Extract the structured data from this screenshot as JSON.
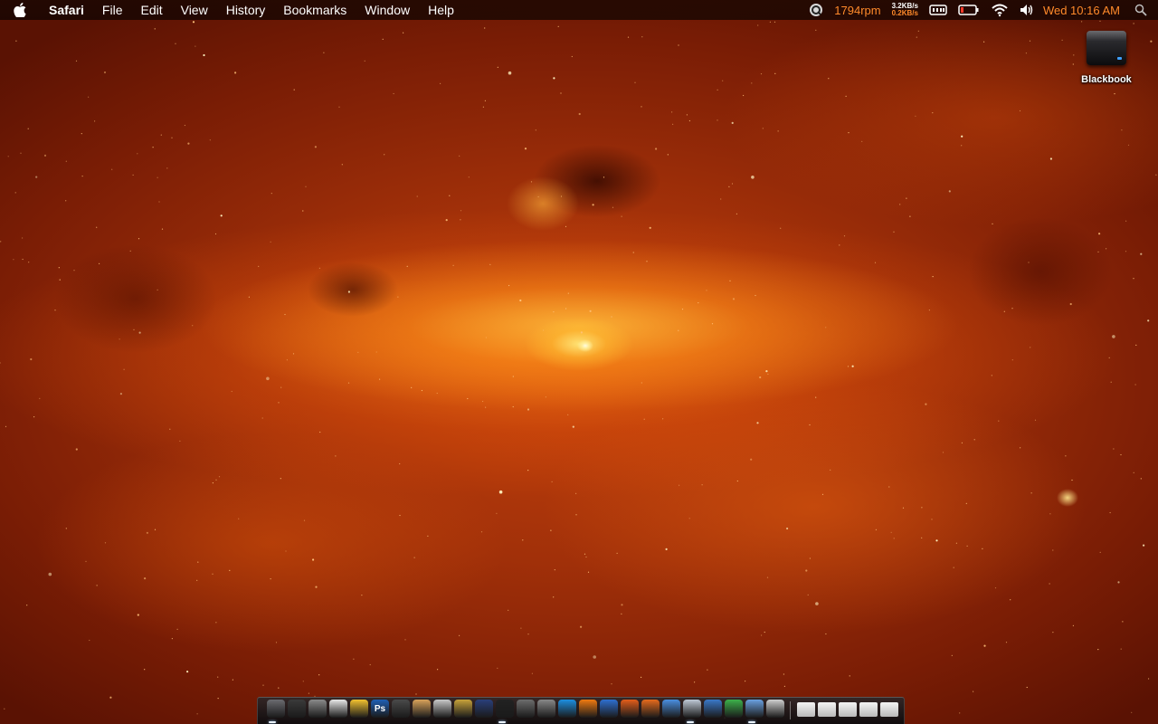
{
  "menubar": {
    "app_name": "Safari",
    "items": [
      "File",
      "Edit",
      "View",
      "History",
      "Bookmarks",
      "Window",
      "Help"
    ],
    "status": {
      "fan_speed": "1794rpm",
      "net_up": "3.2KB/s",
      "net_down": "0.2KB/s",
      "clock": "Wed 10:16 AM"
    },
    "icons": [
      "apple-icon",
      "quicksilver-icon",
      "memory-icon",
      "battery-icon",
      "wifi-icon",
      "volume-icon",
      "spotlight-icon"
    ],
    "accent_color": "#ff8a2a"
  },
  "desktop": {
    "drive_label": "Blackbook"
  },
  "dock": {
    "apps": [
      {
        "name": "Pixelmator"
      },
      {
        "name": "Dashboard"
      },
      {
        "name": "Screenshot"
      },
      {
        "name": "iCal"
      },
      {
        "name": "Things"
      },
      {
        "name": "Photoshop",
        "text": "Ps"
      },
      {
        "name": "Aperture"
      },
      {
        "name": "iPhoto"
      },
      {
        "name": "Preview"
      },
      {
        "name": "iMovie"
      },
      {
        "name": "iDVD"
      },
      {
        "name": "Final Cut"
      },
      {
        "name": "Xcode"
      },
      {
        "name": "Automator"
      },
      {
        "name": "QuickTime"
      },
      {
        "name": "VLC"
      },
      {
        "name": "Word"
      },
      {
        "name": "PowerPoint"
      },
      {
        "name": "Firefox"
      },
      {
        "name": "Finder"
      },
      {
        "name": "Safari"
      },
      {
        "name": "Photo Booth"
      },
      {
        "name": "Messenger"
      },
      {
        "name": "Mail"
      },
      {
        "name": "Terminal"
      }
    ],
    "stacks": [
      {
        "name": "Applications folder"
      },
      {
        "name": "Documents folder"
      },
      {
        "name": "Downloads folder"
      },
      {
        "name": "Desktop folder"
      },
      {
        "name": "Trash"
      }
    ]
  }
}
